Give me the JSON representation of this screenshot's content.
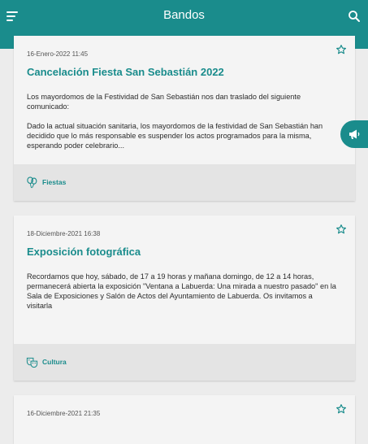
{
  "header": {
    "title": "Bandos",
    "menu_icon": "hamburger-menu-icon",
    "search_icon": "search-icon",
    "color": "#1a8c8c"
  },
  "cards": [
    {
      "date": "16-Enero-2022 11:45",
      "title": "Cancelación Fiesta San Sebastián 2022",
      "body": [
        "Los mayordomos de la Festividad de San Sebastián nos dan traslado del siguiente comunicado:",
        "Dado la actual situación sanitaria, los mayordomos de la festividad de San Sebastián han decidido que lo más responsable es suspender los actos programados para la misma, esperando poder celebrario..."
      ],
      "category": "Fiestas",
      "category_icon": "balloons-icon"
    },
    {
      "date": "18-Diciembre-2021 16:38",
      "title": "Exposición fotográfica",
      "body": [
        "Recordamos que hoy, sábado, de 17 a 19 horas y mañana domingo, de 12 a 14 horas, permanecerá abierta la exposición \"Ventana a Labuerda: Una mirada a nuestro pasado\" en la Sala de Exposiciones y Salón de Actos del Ayuntamiento de Labuerda. Os invitamos a visitarla"
      ],
      "category": "Cultura",
      "category_icon": "theater-masks-icon"
    },
    {
      "date": "16-Diciembre-2021 21:35"
    }
  ],
  "fab": {
    "icon": "megaphone-icon"
  }
}
